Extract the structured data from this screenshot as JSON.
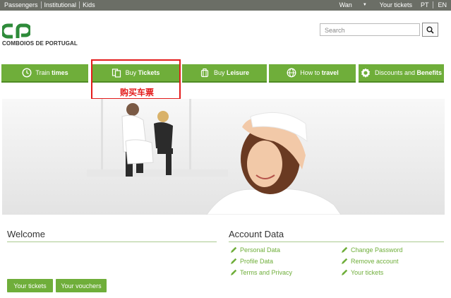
{
  "topbar": {
    "links": [
      "Passengers",
      "Institutional",
      "Kids"
    ],
    "user": "Wan",
    "your_tickets": "Your tickets",
    "lang_pt": "PT",
    "lang_en": "EN"
  },
  "header": {
    "logo_text": "COMBOIOS DE PORTUGAL",
    "search_placeholder": "Search"
  },
  "nav": {
    "train_times": {
      "pre": "Train ",
      "bold": "times"
    },
    "buy_tickets": {
      "pre": "Buy ",
      "bold": "Tickets"
    },
    "buy_leisure": {
      "pre": "Buy ",
      "bold": "Leisure"
    },
    "how_to_travel": {
      "pre": "How to ",
      "bold": "travel"
    },
    "discounts": {
      "pre": "Discounts and ",
      "bold": "Benefits"
    }
  },
  "annotation": {
    "label": "购买车票"
  },
  "welcome": {
    "title": "Welcome",
    "your_tickets_btn": "Your tickets",
    "your_vouchers_btn": "Your vouchers"
  },
  "account": {
    "title": "Account Data",
    "links_left": [
      "Personal Data",
      "Profile Data",
      "Terms and Privacy"
    ],
    "links_right": [
      "Change Password",
      "Remove account",
      "Your tickets"
    ]
  },
  "colors": {
    "brand_green": "#6fae3a",
    "topbar": "#6b6e66",
    "annotation_red": "#e31b1b"
  }
}
